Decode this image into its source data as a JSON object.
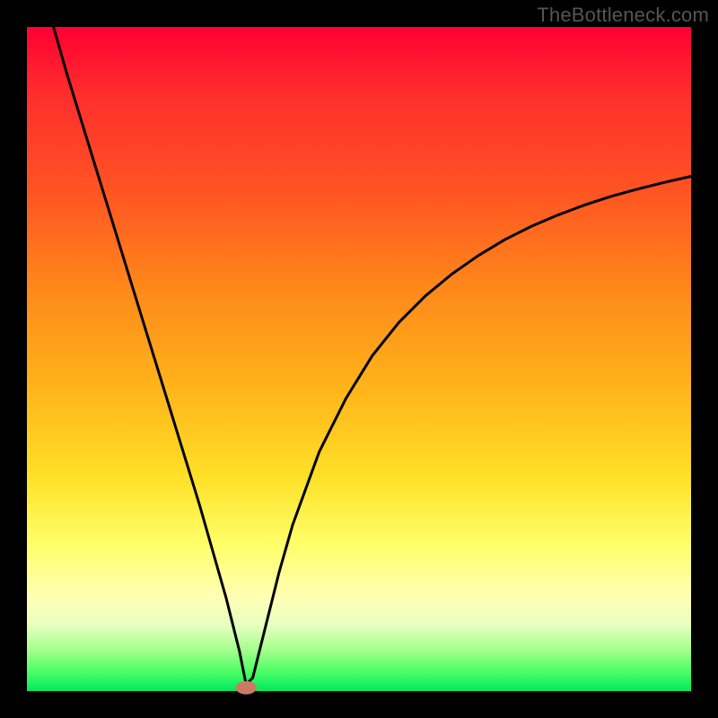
{
  "watermark": "TheBottleneck.com",
  "chart_data": {
    "type": "line",
    "title": "",
    "xlabel": "",
    "ylabel": "",
    "xlim": [
      0,
      100
    ],
    "ylim": [
      0,
      100
    ],
    "grid": false,
    "legend": null,
    "background_gradient": {
      "orientation": "vertical",
      "stops": [
        {
          "pos": 0.0,
          "color": "#ff0033"
        },
        {
          "pos": 0.4,
          "color": "#ff8a1a"
        },
        {
          "pos": 0.7,
          "color": "#ffe128"
        },
        {
          "pos": 0.88,
          "color": "#ffffb5"
        },
        {
          "pos": 1.0,
          "color": "#00e85e"
        }
      ]
    },
    "series": [
      {
        "name": "bottleneck-curve",
        "color": "#000000",
        "stroke_width": 3,
        "x": [
          4,
          6,
          8,
          10,
          12,
          14,
          16,
          18,
          20,
          22,
          24,
          26,
          28,
          30,
          32,
          33,
          34,
          36,
          38,
          40,
          44,
          48,
          52,
          56,
          60,
          64,
          68,
          72,
          76,
          80,
          84,
          88,
          92,
          96,
          100
        ],
        "y": [
          100,
          93,
          86.5,
          80,
          73.5,
          67,
          60.5,
          54,
          47.5,
          41,
          34.5,
          28,
          21,
          14,
          6,
          1,
          2,
          10,
          18,
          25,
          36,
          44,
          50.5,
          55.5,
          59.5,
          62.8,
          65.6,
          68,
          70,
          71.7,
          73.2,
          74.5,
          75.6,
          76.6,
          77.5
        ]
      }
    ],
    "marker": {
      "name": "optimal-point",
      "x": 33,
      "y": 0.5,
      "rx": 1.6,
      "ry": 1.0,
      "color": "#cc7a66"
    }
  }
}
